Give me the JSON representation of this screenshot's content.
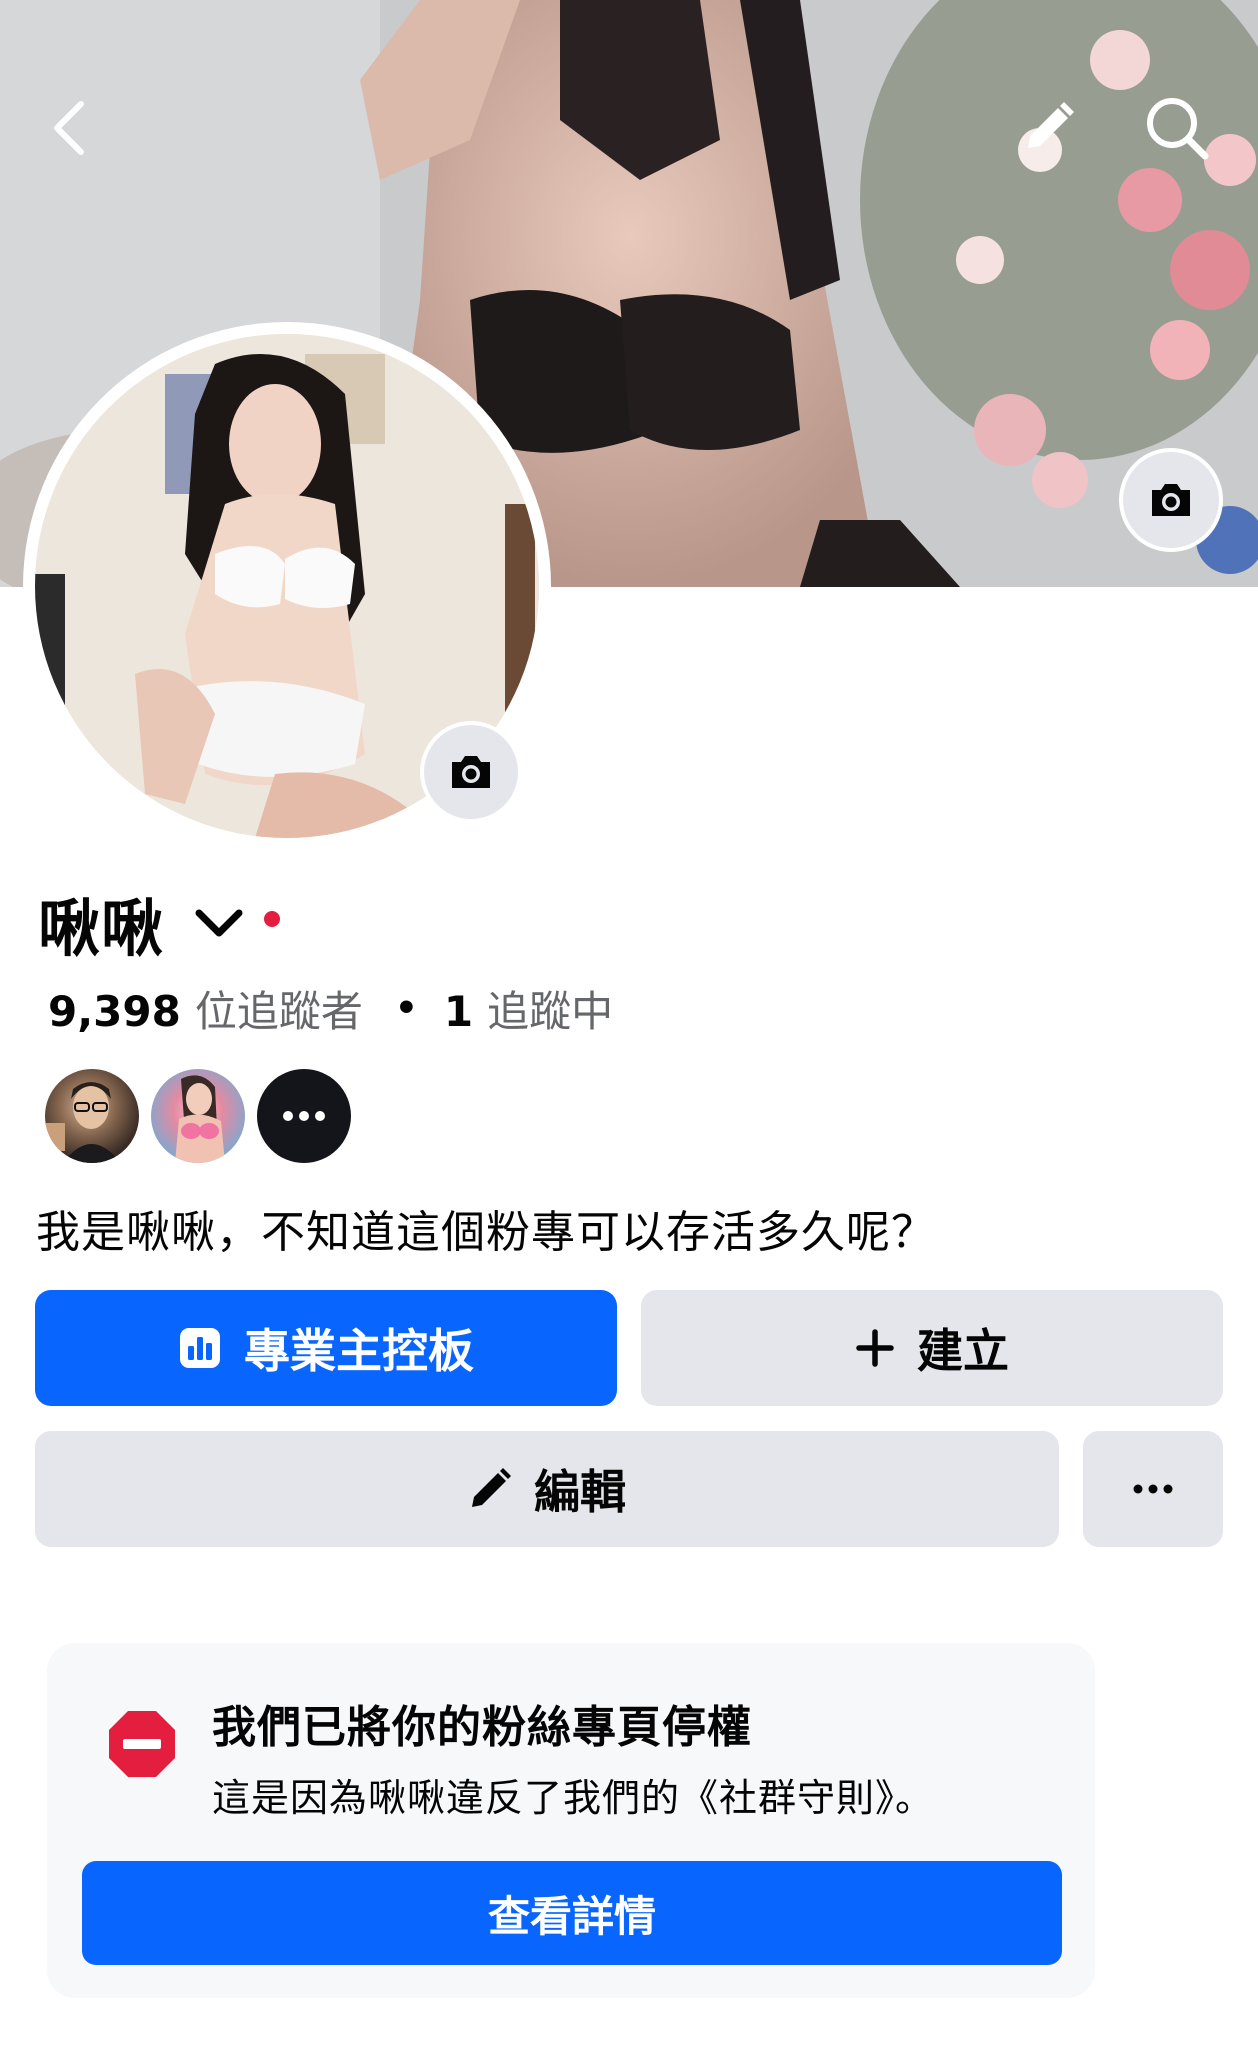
{
  "header": {
    "back_icon": "chevron-left-icon",
    "edit_icon": "pencil-icon",
    "search_icon": "search-icon",
    "cover_camera_icon": "camera-icon"
  },
  "profile": {
    "name": "啾啾",
    "name_menu_icon": "chevron-down-icon",
    "status_dot_color": "#e41e3f",
    "avatar_camera_icon": "camera-icon",
    "followers_count": "9,398",
    "followers_label": "位追蹤者",
    "separator": "•",
    "following_count": "1",
    "following_label": "追蹤中",
    "follower_avatars": [
      "avatar",
      "avatar",
      "more-icon"
    ],
    "bio": "我是啾啾，不知道這個粉專可以存活多久呢？"
  },
  "actions": {
    "dashboard_label": "專業主控板",
    "dashboard_icon": "dashboard-chart-icon",
    "create_label": "建立",
    "create_icon": "plus-icon",
    "edit_label": "編輯",
    "edit_icon": "pencil-icon",
    "more_icon": "more-horizontal-icon"
  },
  "notice": {
    "icon": "stop-sign-icon",
    "title": "我們已將你的粉絲專頁停權",
    "body": "這是因為啾啾違反了我們的《社群守則》。",
    "button_label": "查看詳情"
  },
  "colors": {
    "primary_blue": "#0866ff",
    "secondary_gray": "#e4e6eb",
    "alert_red": "#e41e3f",
    "card_bg": "#f7f8fa"
  }
}
